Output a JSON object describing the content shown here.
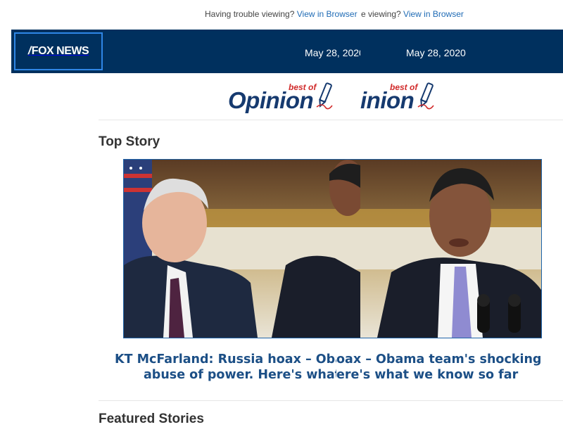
{
  "topbar": {
    "trouble_text": "Having trouble viewing?",
    "trouble_text_partial": "e viewing?",
    "browser_link": "View in Browser"
  },
  "header": {
    "logo_text": "FOX NEWS",
    "logo_slash": "/",
    "date": "May 28, 2020"
  },
  "banner": {
    "word": "Opinion",
    "word_partial": "inion",
    "best_of": "best of"
  },
  "top_story": {
    "section_title": "Top Story",
    "headline_line1_left": "KT McFarland: Russia hoax – Obama te",
    "headline_line1_right": "oax – Obama team's shocking",
    "headline_line2_left": "abuse of power. Here's what we kr",
    "headline_line2_right": "ere's what we know so far"
  },
  "featured": {
    "section_title": "Featured Stories"
  },
  "colors": {
    "header_bg": "#00305e",
    "logo_border": "#2f86e6",
    "link": "#1f6bb5",
    "headline": "#1c4f86",
    "opinion_blue": "#163a6f",
    "best_of_red": "#d12b2b"
  },
  "icons": [
    "pen-icon"
  ]
}
